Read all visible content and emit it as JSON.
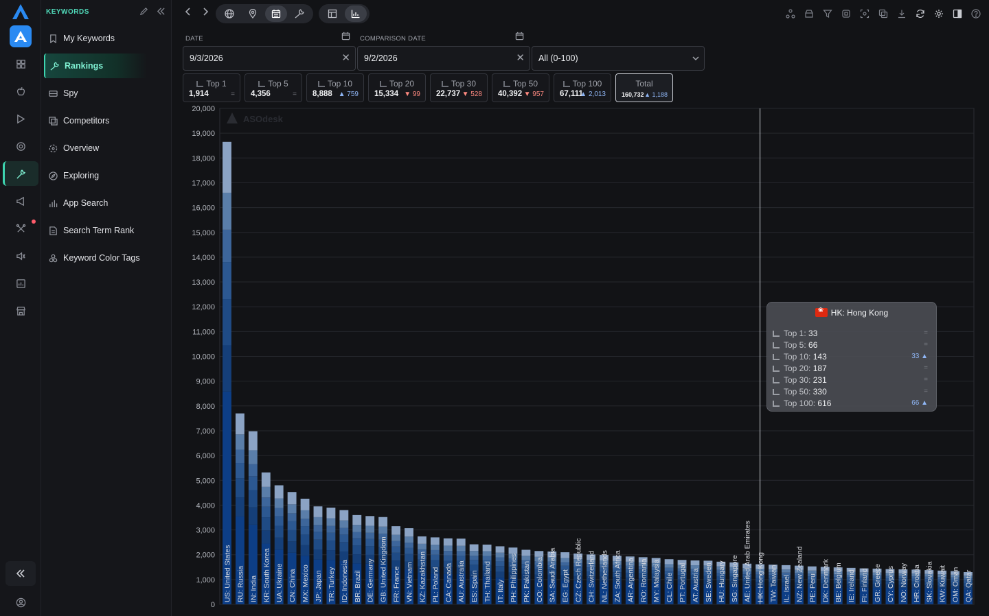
{
  "sidebar": {
    "heading": "KEYWORDS",
    "items": [
      {
        "label": "My Keywords",
        "icon": "bookmark-icon"
      },
      {
        "label": "Rankings",
        "icon": "wrench-icon",
        "active": true
      },
      {
        "label": "Spy",
        "icon": "spy-icon"
      },
      {
        "label": "Competitors",
        "icon": "copy-icon"
      },
      {
        "label": "Overview",
        "icon": "target-icon"
      },
      {
        "label": "Exploring",
        "icon": "compass-icon"
      },
      {
        "label": "App Search",
        "icon": "bar-chart-icon"
      },
      {
        "label": "Search Term Rank",
        "icon": "document-icon"
      },
      {
        "label": "Keyword Color Tags",
        "icon": "tags-icon"
      }
    ]
  },
  "filters": {
    "date_label": "DATE",
    "date_value": "9/3/2026",
    "comparison_label": "COMPARISON DATE",
    "comparison_value": "9/2/2026",
    "range_value": "All (0-100)"
  },
  "stats": [
    {
      "label": "Top 1",
      "value": "1,914",
      "delta": "=",
      "dir": "eq"
    },
    {
      "label": "Top 5",
      "value": "4,356",
      "delta": "=",
      "dir": "eq"
    },
    {
      "label": "Top 10",
      "value": "8,888",
      "delta": "▲ 759",
      "dir": "up"
    },
    {
      "label": "Top 20",
      "value": "15,334",
      "delta": "▼ 99",
      "dir": "down"
    },
    {
      "label": "Top 30",
      "value": "22,737",
      "delta": "▼ 528",
      "dir": "down"
    },
    {
      "label": "Top 50",
      "value": "40,392",
      "delta": "▼ 957",
      "dir": "down"
    },
    {
      "label": "Top 100",
      "value": "67,111",
      "delta": "▲ 2,013",
      "dir": "up"
    },
    {
      "label": "Total",
      "value": "160,732",
      "delta": "▲ 1,188",
      "dir": "up",
      "selected": true
    }
  ],
  "tooltip": {
    "title": "HK: Hong Kong",
    "rows": [
      {
        "label": "Top 1:",
        "value": "33",
        "delta": "=",
        "dir": "eq"
      },
      {
        "label": "Top 5:",
        "value": "66",
        "delta": "=",
        "dir": "eq"
      },
      {
        "label": "Top 10:",
        "value": "143",
        "delta": "33 ▲",
        "dir": "up"
      },
      {
        "label": "Top 20:",
        "value": "187",
        "delta": "=",
        "dir": "eq"
      },
      {
        "label": "Top 30:",
        "value": "231",
        "delta": "=",
        "dir": "eq"
      },
      {
        "label": "Top 50:",
        "value": "330",
        "delta": "=",
        "dir": "eq"
      },
      {
        "label": "Top 100:",
        "value": "616",
        "delta": "66 ▲",
        "dir": "up"
      }
    ]
  },
  "colors": {
    "accent": "#3ed6b1",
    "bar_dark": "#0d3e86",
    "bar_light": "#8ba3c4"
  },
  "chart_data": {
    "type": "bar",
    "stacked": true,
    "watermark": "ASOdesk",
    "ylim": [
      0,
      20000
    ],
    "yticks": [
      "20,000",
      "19,000",
      "18,000",
      "17,000",
      "16,000",
      "15,000",
      "14,000",
      "13,000",
      "12,000",
      "11,000",
      "10,000",
      "9,000",
      "8,000",
      "7,000",
      "6,000",
      "5,000",
      "4,000",
      "3,000",
      "2,000",
      "1,000",
      "0"
    ],
    "grid": true,
    "highlight_category": "HK: Hong Kong",
    "categories": [
      "US: United States",
      "RU: Russia",
      "IN: India",
      "KR: South Korea",
      "UA: Ukraine",
      "CN: China",
      "MX: Mexico",
      "JP: Japan",
      "TR: Turkey",
      "ID: Indonesia",
      "BR: Brazil",
      "DE: Germany",
      "GB: United Kingdom",
      "FR: France",
      "VN: Vietnam",
      "KZ: Kazakhstan",
      "PL: Poland",
      "CA: Canada",
      "AU: Australia",
      "ES: Spain",
      "TH: Thailand",
      "IT: Italy",
      "PH: Philippines",
      "PK: Pakistan",
      "CO: Colombia",
      "SA: Saudi Arabia",
      "EG: Egypt",
      "CZ: Czech Republic",
      "CH: Switzerland",
      "NL: Netherlands",
      "ZA: South Africa",
      "AR: Argentina",
      "RO: Romania",
      "MY: Malaysia",
      "CL: Chile",
      "PT: Portugal",
      "AT: Austria",
      "SE: Sweden",
      "HU: Hungary",
      "SG: Singapore",
      "AE: United Arab Emirates",
      "HK: Hong Kong",
      "TW: Taiwan",
      "IL: Israel",
      "NZ: New Zealand",
      "PE: Peru",
      "DK: Denmark",
      "BE: Belgium",
      "IE: Ireland",
      "FI: Finland",
      "GR: Greece",
      "CY: Cyprus",
      "NO: Norway",
      "HR: Croatia",
      "SK: Slovakia",
      "KW: Kuwait",
      "OM: Oman",
      "QA: Qatar"
    ],
    "values": [
      18650,
      7700,
      6980,
      5320,
      4800,
      4530,
      4260,
      3950,
      3900,
      3800,
      3600,
      3560,
      3520,
      3150,
      3070,
      2740,
      2700,
      2660,
      2650,
      2420,
      2410,
      2340,
      2290,
      2200,
      2150,
      2130,
      2100,
      2050,
      2010,
      1990,
      1960,
      1930,
      1900,
      1870,
      1820,
      1790,
      1770,
      1760,
      1720,
      1690,
      1640,
      1616,
      1600,
      1580,
      1560,
      1530,
      1510,
      1490,
      1470,
      1450,
      1440,
      1420,
      1410,
      1400,
      1380,
      1360,
      1340,
      1300
    ]
  }
}
